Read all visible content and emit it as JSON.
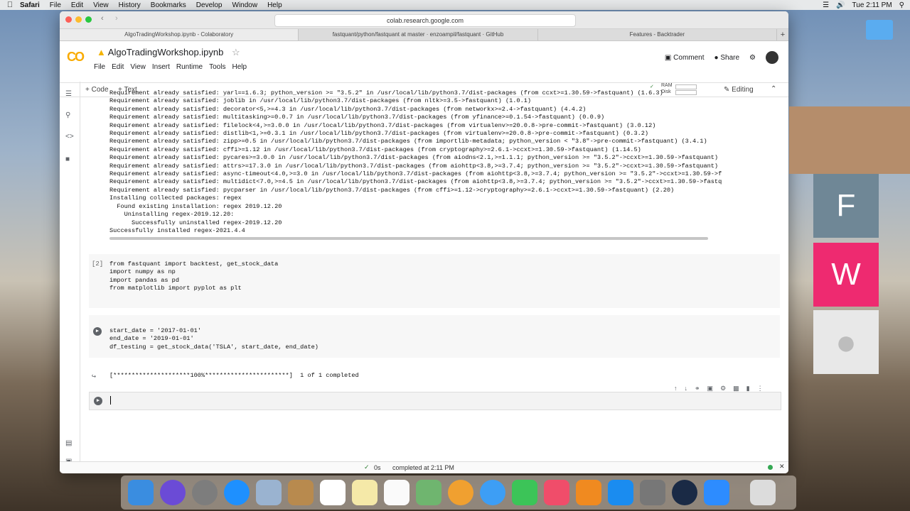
{
  "menubar": {
    "app": "Safari",
    "items": [
      "File",
      "Edit",
      "View",
      "History",
      "Bookmarks",
      "Develop",
      "Window",
      "Help"
    ],
    "clock": "Tue 2:11 PM"
  },
  "browser": {
    "url": "colab.research.google.com",
    "tabs": [
      "AlgoTradingWorkshop.ipynb - Colaboratory",
      "fastquant/python/fastquant at master · enzoampil/fastquant · GitHub",
      "Features - Backtrader"
    ]
  },
  "colab": {
    "logo": "CO",
    "title": "AlgoTradingWorkshop.ipynb",
    "menus": [
      "File",
      "Edit",
      "View",
      "Insert",
      "Runtime",
      "Tools",
      "Help"
    ],
    "comment": "Comment",
    "share": "Share",
    "add_code": "+ Code",
    "add_text": "+ Text",
    "ram": "RAM",
    "disk": "Disk",
    "editing": "Editing"
  },
  "output_lines": [
    "Requirement already satisfied: yarl==1.6.3; python_version >= \"3.5.2\" in /usr/local/lib/python3.7/dist-packages (from ccxt>=1.30.59->fastquant) (1.6.3)",
    "Requirement already satisfied: joblib in /usr/local/lib/python3.7/dist-packages (from nltk>=3.5->fastquant) (1.0.1)",
    "Requirement already satisfied: decorator<5,>=4.3 in /usr/local/lib/python3.7/dist-packages (from networkx>=2.4->fastquant) (4.4.2)",
    "Requirement already satisfied: multitasking>=0.0.7 in /usr/local/lib/python3.7/dist-packages (from yfinance>=0.1.54->fastquant) (0.0.9)",
    "Requirement already satisfied: filelock<4,>=3.0.0 in /usr/local/lib/python3.7/dist-packages (from virtualenv>=20.0.8->pre-commit->fastquant) (3.0.12)",
    "Requirement already satisfied: distlib<1,>=0.3.1 in /usr/local/lib/python3.7/dist-packages (from virtualenv>=20.0.8->pre-commit->fastquant) (0.3.2)",
    "Requirement already satisfied: zipp>=0.5 in /usr/local/lib/python3.7/dist-packages (from importlib-metadata; python_version < \"3.8\"->pre-commit->fastquant) (3.4.1)",
    "Requirement already satisfied: cffi>=1.12 in /usr/local/lib/python3.7/dist-packages (from cryptography>=2.6.1->ccxt>=1.30.59->fastquant) (1.14.5)",
    "Requirement already satisfied: pycares>=3.0.0 in /usr/local/lib/python3.7/dist-packages (from aiodns<2.1,>=1.1.1; python_version >= \"3.5.2\"->ccxt>=1.30.59->fastquant)",
    "Requirement already satisfied: attrs>=17.3.0 in /usr/local/lib/python3.7/dist-packages (from aiohttp<3.8,>=3.7.4; python_version >= \"3.5.2\"->ccxt>=1.30.59->fastquant)",
    "Requirement already satisfied: async-timeout<4.0,>=3.0 in /usr/local/lib/python3.7/dist-packages (from aiohttp<3.8,>=3.7.4; python_version >= \"3.5.2\"->ccxt>=1.30.59->f",
    "Requirement already satisfied: multidict<7.0,>=4.5 in /usr/local/lib/python3.7/dist-packages (from aiohttp<3.8,>=3.7.4; python_version >= \"3.5.2\"->ccxt>=1.30.59->fastq",
    "Requirement already satisfied: pycparser in /usr/local/lib/python3.7/dist-packages (from cffi>=1.12->cryptography>=2.6.1->ccxt>=1.30.59->fastquant) (2.20)",
    "Installing collected packages: regex",
    "  Found existing installation: regex 2019.12.20",
    "    Uninstalling regex-2019.12.20:",
    "      Successfully uninstalled regex-2019.12.20",
    "Successfully installed regex-2021.4.4"
  ],
  "cell2": {
    "prompt": "[2]",
    "lines": [
      "from fastquant import backtest, get_stock_data",
      "",
      "import numpy as np",
      "import pandas as pd",
      "from matplotlib import pyplot as plt"
    ]
  },
  "cell3": {
    "lines": [
      "start_date = '2017-01-01'",
      "end_date = '2019-01-01'",
      "",
      "df_testing = get_stock_data('TSLA', start_date, end_date)"
    ],
    "output": "[*********************100%***********************]  1 of 1 completed"
  },
  "status": {
    "time": "0s",
    "text": "completed at 2:11 PM"
  },
  "video": {
    "tiles": [
      "F",
      "W"
    ],
    "colors": {
      "F": "#6f8796",
      "W": "#ee2a70"
    }
  }
}
